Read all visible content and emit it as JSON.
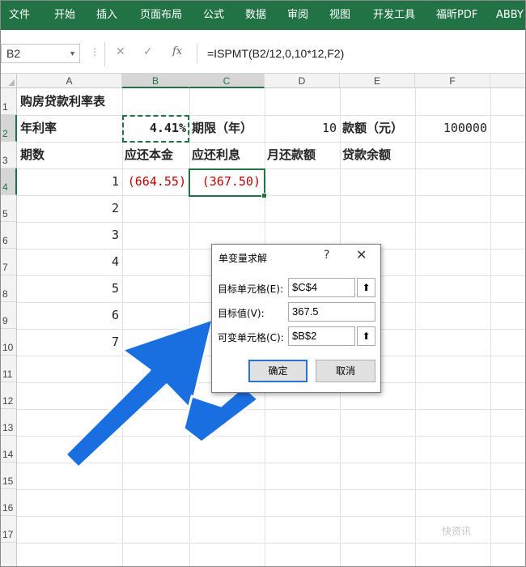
{
  "ribbon": {
    "tabs": [
      "文件",
      "开始",
      "插入",
      "页面布局",
      "公式",
      "数据",
      "审阅",
      "视图",
      "开发工具",
      "福昕PDF",
      "ABBY"
    ]
  },
  "formula_bar": {
    "name_box": "B2",
    "cancel_icon": "✕",
    "enter_icon": "✓",
    "fx_label": "fx",
    "formula": "=ISPMT(B2/12,0,10*12,F2)"
  },
  "columns": [
    "A",
    "B",
    "C",
    "D",
    "E",
    "F"
  ],
  "rows": [
    "1",
    "2",
    "3",
    "4",
    "5",
    "6",
    "7",
    "8",
    "9",
    "10",
    "11",
    "12",
    "13",
    "14",
    "15",
    "16",
    "17"
  ],
  "sheet": {
    "a1": "购房贷款利率表",
    "a2": "年利率",
    "b2": "4.41%",
    "c2": "期限（年）",
    "d2": "10",
    "e2": "款额（元）",
    "f2": "100000",
    "a3": "期数",
    "b3": "应还本金",
    "c3": "应还利息",
    "d3": "月还款额",
    "e3": "贷款余额",
    "period_numbers": [
      "1",
      "2",
      "3",
      "4",
      "5",
      "6",
      "7"
    ],
    "b4": "(664.55)",
    "c4": "(367.50)"
  },
  "dialog": {
    "title": "单变量求解",
    "help": "?",
    "close": "✕",
    "target_cell_label": "目标单元格(E):",
    "target_cell_value": "$C$4",
    "target_value_label": "目标值(V):",
    "target_value": "367.5",
    "changing_cell_label": "可变单元格(C):",
    "changing_cell_value": "$B$2",
    "collapse_icon": "⬆",
    "ok_label": "确定",
    "cancel_label": "取消"
  },
  "colors": {
    "ribbon": "#217346",
    "annotation_arrow": "#1a6fe0",
    "negative_value": "#c00000"
  },
  "watermark": "快资讯"
}
